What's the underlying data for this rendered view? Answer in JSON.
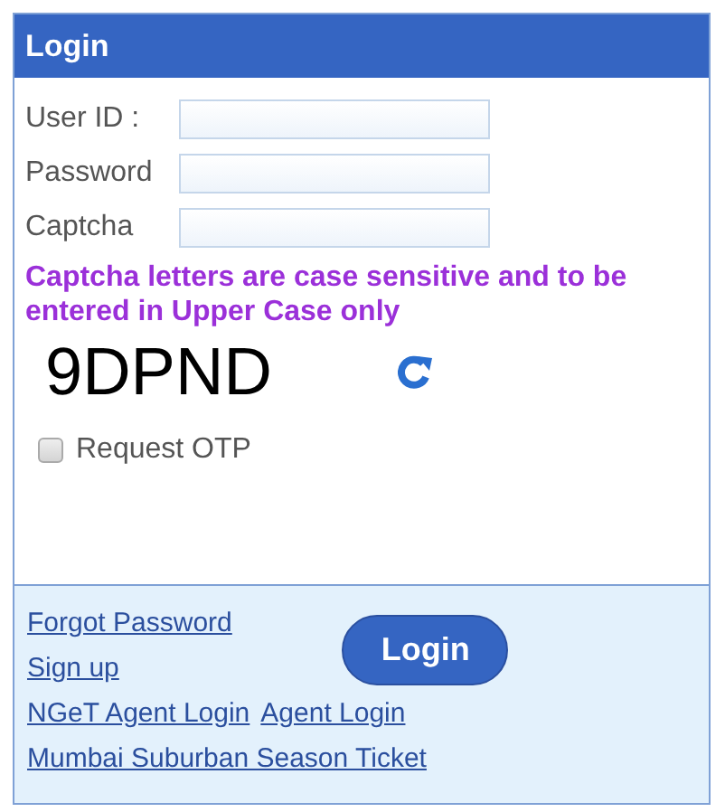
{
  "panel": {
    "title": "Login"
  },
  "fields": [
    {
      "label": "User ID :"
    },
    {
      "label": "Password"
    },
    {
      "label": "Captcha"
    }
  ],
  "captcha_note": "Captcha letters are case sensitive and to be entered in Upper Case only",
  "captcha_text": "9DPND",
  "request_otp": {
    "label": "Request OTP",
    "checked": false
  },
  "links": [
    "Forgot Password",
    "Sign up",
    "NGeT Agent Login",
    "Agent Login",
    "Mumbai Suburban Season Ticket"
  ],
  "login_button": "Login"
}
